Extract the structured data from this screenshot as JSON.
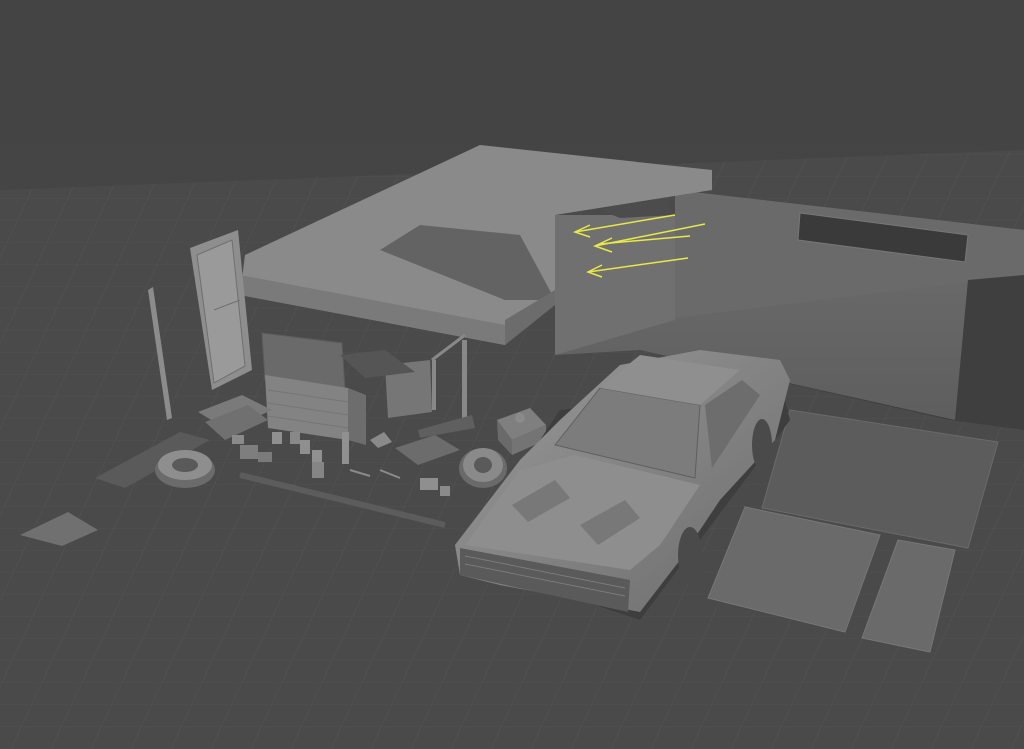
{
  "viewport": {
    "kind": "3d-modeling-viewport",
    "shading": "solid-grey",
    "grid": true,
    "colors": {
      "background": "#434343",
      "grid_line": "#5a5a5a",
      "ground": "#4a4a4a",
      "object_light": "#8a8a8a",
      "object_mid": "#6e6e6e",
      "object_dark": "#545454",
      "shadow": "#3b3b3b",
      "light_gizmo": "#e8e84a"
    }
  },
  "scene": {
    "objects": [
      {
        "name": "canopy-roof",
        "icon": "mesh-icon"
      },
      {
        "name": "back-wall",
        "icon": "mesh-icon"
      },
      {
        "name": "wall-window",
        "icon": "mesh-icon"
      },
      {
        "name": "door",
        "icon": "mesh-icon"
      },
      {
        "name": "pole",
        "icon": "mesh-icon"
      },
      {
        "name": "tool-cabinet",
        "icon": "mesh-icon"
      },
      {
        "name": "workbench",
        "icon": "mesh-icon"
      },
      {
        "name": "tire-left",
        "icon": "mesh-icon"
      },
      {
        "name": "tire-right",
        "icon": "mesh-icon"
      },
      {
        "name": "engine-block",
        "icon": "mesh-icon"
      },
      {
        "name": "muscle-car",
        "icon": "mesh-icon"
      },
      {
        "name": "floor-slabs",
        "icon": "mesh-icon"
      },
      {
        "name": "small-props",
        "icon": "mesh-icon"
      },
      {
        "name": "directional-lights",
        "icon": "light-icon"
      }
    ]
  }
}
